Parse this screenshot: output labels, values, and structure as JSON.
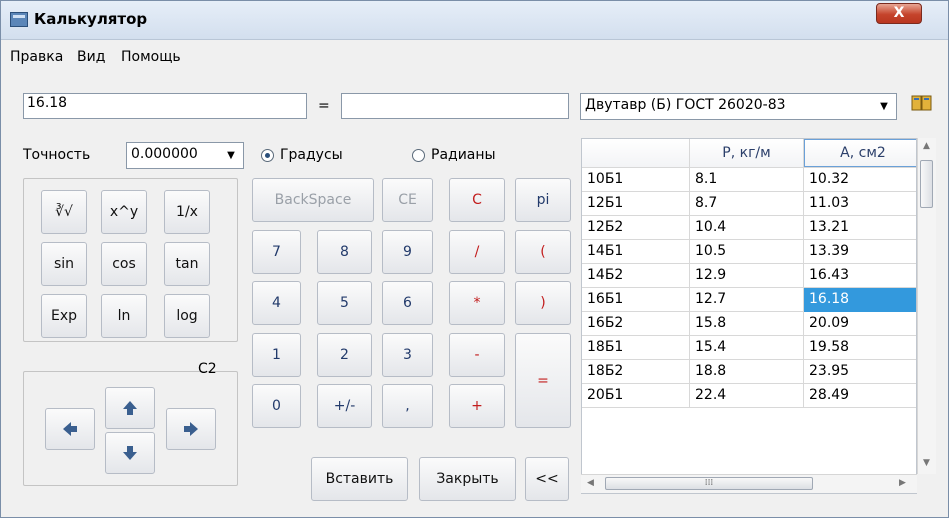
{
  "window": {
    "title": "Калькулятор",
    "close_glyph": "X"
  },
  "menu": [
    "Правка",
    "Вид",
    "Помощь"
  ],
  "expression": {
    "value": "16.18",
    "equals": "=",
    "result": ""
  },
  "profile_select": {
    "value": "Двутавр (Б) ГОСТ 26020-83"
  },
  "precision": {
    "label": "Точность",
    "value": "0.000000"
  },
  "angle_mode": {
    "degrees": "Градусы",
    "radians": "Радианы",
    "selected": "degrees"
  },
  "func_buttons": [
    "∛√",
    "x^y",
    "1/x",
    "sin",
    "cos",
    "tan",
    "Exp",
    "ln",
    "log"
  ],
  "row_top": [
    "BackSpace",
    "CE",
    "C",
    "pi"
  ],
  "digits": [
    "7",
    "8",
    "9",
    "4",
    "5",
    "6",
    "1",
    "2",
    "3",
    "0",
    "+/-",
    ","
  ],
  "ops": [
    "/",
    "(",
    "*",
    ")",
    "-",
    "+",
    "="
  ],
  "nav": {
    "label": "C2"
  },
  "actions": {
    "insert": "Вставить",
    "close": "Закрыть",
    "collapse": "<<"
  },
  "table": {
    "columns": [
      "",
      "P, кг/м",
      "A, см2"
    ],
    "rows": [
      [
        "10Б1",
        "8.1",
        "10.32"
      ],
      [
        "12Б1",
        "8.7",
        "11.03"
      ],
      [
        "12Б2",
        "10.4",
        "13.21"
      ],
      [
        "14Б1",
        "10.5",
        "13.39"
      ],
      [
        "14Б2",
        "12.9",
        "16.43"
      ],
      [
        "16Б1",
        "12.7",
        "16.18"
      ],
      [
        "16Б2",
        "15.8",
        "20.09"
      ],
      [
        "18Б1",
        "15.4",
        "19.58"
      ],
      [
        "18Б2",
        "18.8",
        "23.95"
      ],
      [
        "20Б1",
        "22.4",
        "28.49"
      ]
    ],
    "highlight": {
      "row": 5,
      "col": 2
    }
  },
  "colors": {
    "accent": "#3399dd",
    "op_red": "#c21d1d",
    "digit_blue": "#223a6b"
  }
}
